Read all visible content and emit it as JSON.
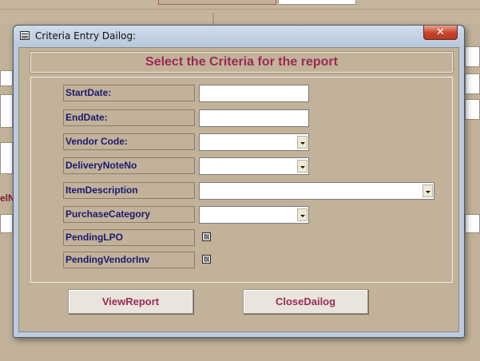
{
  "window": {
    "title": "Criteria Entry Dailog:",
    "close_symbol": "✕"
  },
  "header": {
    "title": "Select the Criteria for the report"
  },
  "fields": {
    "start_date": {
      "label": "StartDate:",
      "value": ""
    },
    "end_date": {
      "label": "EndDate:",
      "value": ""
    },
    "vendor_code": {
      "label": "Vendor Code:",
      "value": ""
    },
    "delivery_note_no": {
      "label": "DeliveryNoteNo",
      "value": ""
    },
    "item_description": {
      "label": "ItemDescription",
      "value": ""
    },
    "purchase_category": {
      "label": "PurchaseCategory",
      "value": ""
    },
    "pending_lpo": {
      "label": "PendingLPO",
      "checked": "indeterminate"
    },
    "pending_vendor_inv": {
      "label": "PendingVendorInv",
      "checked": "indeterminate"
    }
  },
  "buttons": {
    "view_report": "ViewReport",
    "close_dialog": "CloseDailog"
  },
  "background": {
    "partial_label": "elN"
  },
  "colors": {
    "form_background": "#c2b29a",
    "label_text": "#1a1a6e",
    "accent_text": "#9b2a55"
  }
}
